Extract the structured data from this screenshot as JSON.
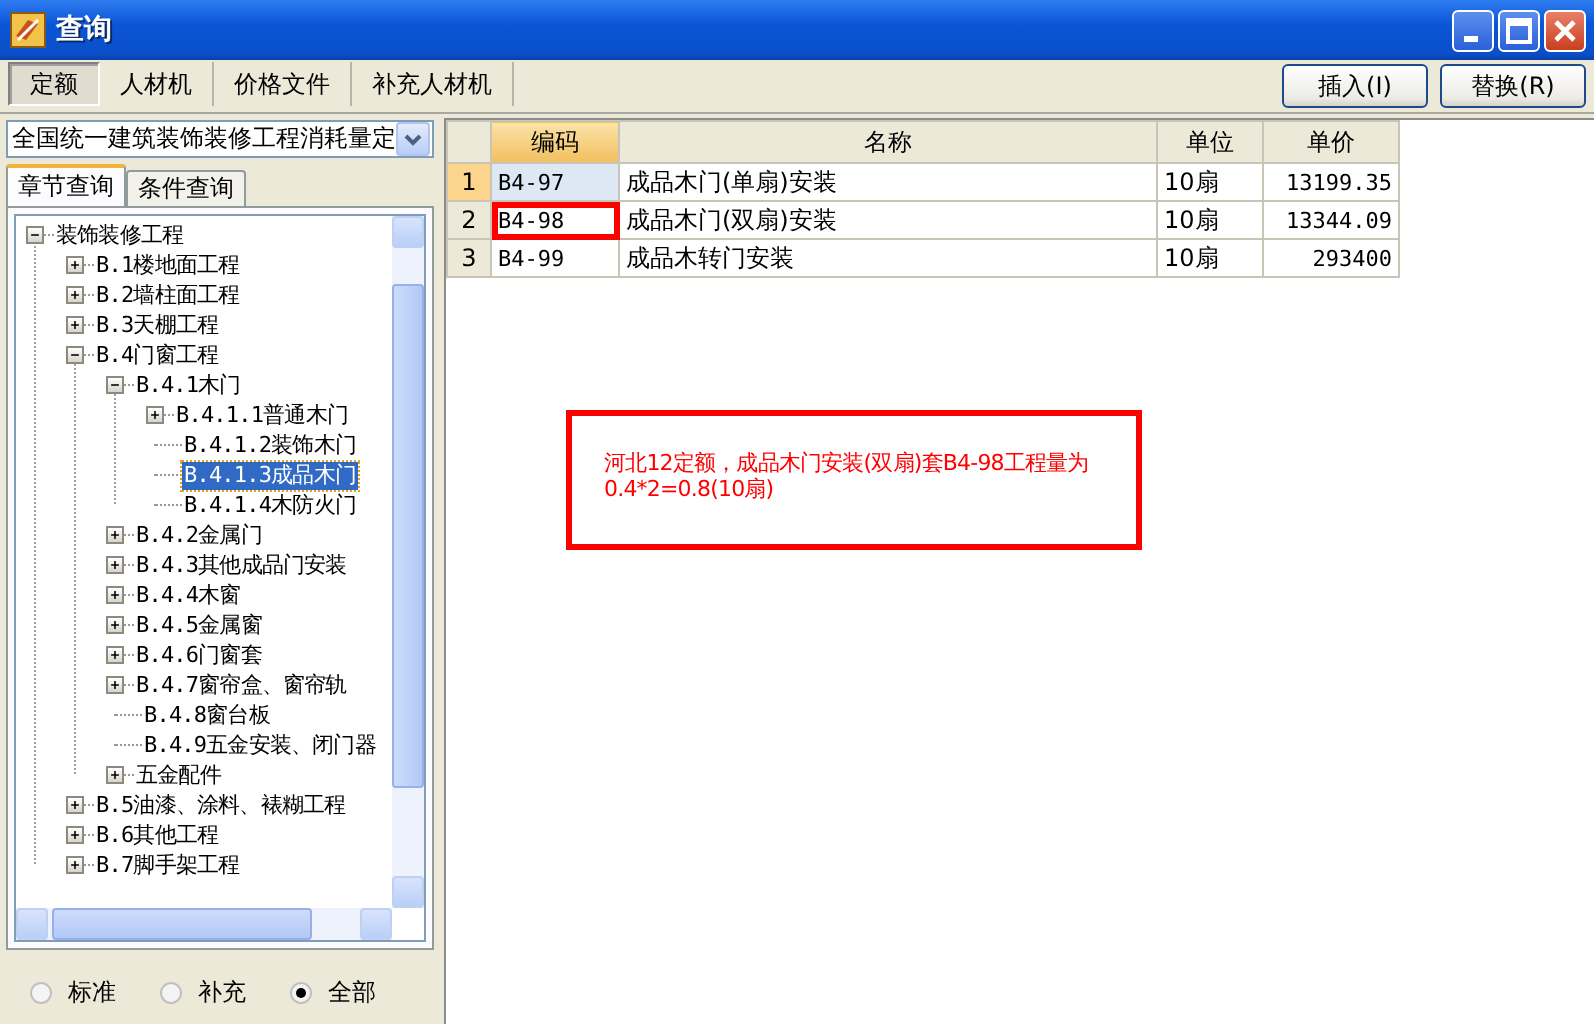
{
  "window": {
    "title": "查询"
  },
  "tabs": [
    {
      "label": "定额",
      "selected": true
    },
    {
      "label": "人材机",
      "selected": false
    },
    {
      "label": "价格文件",
      "selected": false
    },
    {
      "label": "补充人材机",
      "selected": false
    }
  ],
  "buttons": [
    "插入(I)",
    "替换(R)"
  ],
  "library_dropdown": {
    "value": "全国统一建筑装饰装修工程消耗量定"
  },
  "sub_tabs": [
    {
      "label": "章节查询",
      "selected": true
    },
    {
      "label": "条件查询",
      "selected": false
    }
  ],
  "tree": {
    "items": [
      {
        "label": "装饰装修工程",
        "kind": "branch",
        "expanded": true,
        "selected": false,
        "children": [
          {
            "label": "B.1楼地面工程",
            "kind": "branch",
            "expanded": false,
            "selected": false
          },
          {
            "label": "B.2墙柱面工程",
            "kind": "branch",
            "expanded": false,
            "selected": false
          },
          {
            "label": "B.3天棚工程",
            "kind": "branch",
            "expanded": false,
            "selected": false
          },
          {
            "label": "B.4门窗工程",
            "kind": "branch",
            "expanded": true,
            "selected": false,
            "children": [
              {
                "label": "B.4.1木门",
                "kind": "branch",
                "expanded": true,
                "selected": false,
                "children": [
                  {
                    "label": "B.4.1.1普通木门",
                    "kind": "branch",
                    "expanded": false,
                    "selected": false
                  },
                  {
                    "label": "B.4.1.2装饰木门",
                    "kind": "leaf",
                    "selected": false
                  },
                  {
                    "label": "B.4.1.3成品木门",
                    "kind": "leaf",
                    "selected": true
                  },
                  {
                    "label": "B.4.1.4木防火门",
                    "kind": "leaf",
                    "selected": false
                  }
                ]
              },
              {
                "label": "B.4.2金属门",
                "kind": "branch",
                "expanded": false,
                "selected": false
              },
              {
                "label": "B.4.3其他成品门安装",
                "kind": "branch",
                "expanded": false,
                "selected": false
              },
              {
                "label": "B.4.4木窗",
                "kind": "branch",
                "expanded": false,
                "selected": false
              },
              {
                "label": "B.4.5金属窗",
                "kind": "branch",
                "expanded": false,
                "selected": false
              },
              {
                "label": "B.4.6门窗套",
                "kind": "branch",
                "expanded": false,
                "selected": false
              },
              {
                "label": "B.4.7窗帘盒、窗帘轨",
                "kind": "branch",
                "expanded": false,
                "selected": false
              },
              {
                "label": "B.4.8窗台板",
                "kind": "leaf",
                "selected": false
              },
              {
                "label": "B.4.9五金安装、闭门器",
                "kind": "leaf",
                "selected": false
              },
              {
                "label": "五金配件",
                "kind": "branch",
                "expanded": false,
                "selected": false
              }
            ]
          },
          {
            "label": "B.5油漆、涂料、裱糊工程",
            "kind": "branch",
            "expanded": false,
            "selected": false
          },
          {
            "label": "B.6其他工程",
            "kind": "branch",
            "expanded": false,
            "selected": false
          },
          {
            "label": "B.7脚手架工程",
            "kind": "branch",
            "expanded": false,
            "selected": false
          }
        ]
      }
    ]
  },
  "filter_radios": [
    {
      "label": "标准",
      "selected": false
    },
    {
      "label": "补充",
      "selected": false
    },
    {
      "label": "全部",
      "selected": true
    }
  ],
  "table": {
    "columns": [
      {
        "label": "编码",
        "selected": true
      },
      {
        "label": "名称",
        "selected": false
      },
      {
        "label": "单位",
        "selected": false
      },
      {
        "label": "单价",
        "selected": false
      }
    ],
    "rows": [
      {
        "number": "1",
        "code": "B4-97",
        "name": "成品木门(单扇)安装",
        "unit": "10扇",
        "price": "13199.35",
        "selected": true,
        "marked": false
      },
      {
        "number": "2",
        "code": "B4-98",
        "name": "成品木门(双扇)安装",
        "unit": "10扇",
        "price": "13344.09",
        "selected": false,
        "marked": true
      },
      {
        "number": "3",
        "code": "B4-99",
        "name": "成品木转门安装",
        "unit": "10扇",
        "price": "293400",
        "selected": false,
        "marked": false
      }
    ]
  },
  "note": {
    "text": "河北12定额，成品木门安装(双扇)套B4-98工程量为0.4*2=0.8(10扇)"
  }
}
